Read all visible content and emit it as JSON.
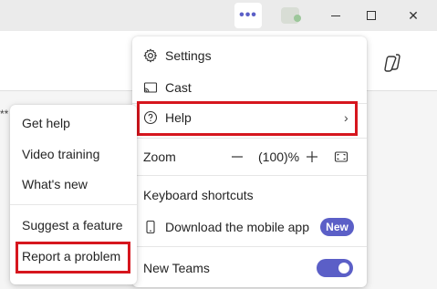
{
  "titlebar": {
    "more_icon": "more-horizontal-icon",
    "more_glyph": "•••",
    "close_glyph": "✕"
  },
  "stars_text": "**",
  "menu": {
    "settings": {
      "label": "Settings",
      "icon": "gear-icon"
    },
    "cast": {
      "label": "Cast",
      "icon": "cast-icon"
    },
    "help": {
      "label": "Help",
      "icon": "question-circle-icon",
      "chevron": "›"
    },
    "zoom": {
      "label": "Zoom",
      "value": "(100)%"
    },
    "keyboard_shortcuts": {
      "label": "Keyboard shortcuts"
    },
    "download_mobile": {
      "label": "Download the mobile app",
      "icon": "phone-icon",
      "badge": "New"
    },
    "new_teams": {
      "label": "New Teams",
      "toggle_on": true
    }
  },
  "submenu": {
    "items": [
      {
        "label": "Get help"
      },
      {
        "label": "Video training"
      },
      {
        "label": "What's new"
      },
      {
        "label": "Suggest a feature"
      },
      {
        "label": "Report a problem"
      }
    ]
  },
  "colors": {
    "accent": "#5b5fc7",
    "highlight_red": "#d6161e"
  }
}
